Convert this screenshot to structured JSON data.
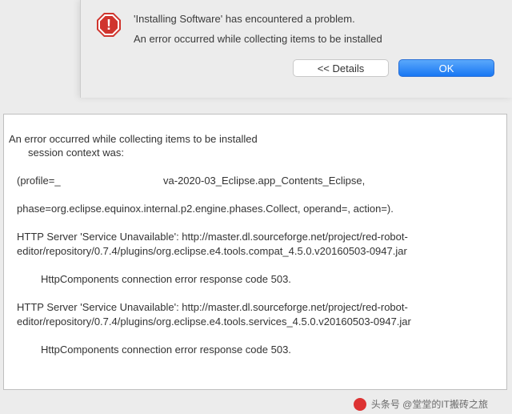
{
  "dialog": {
    "title": "'Installing Software' has encountered a problem.",
    "subtitle": "An error occurred while collecting items to be installed",
    "buttons": {
      "details": "<< Details",
      "ok": "OK"
    }
  },
  "details": {
    "line1": "An error occurred while collecting items to be installed",
    "line2": "session context was:",
    "line3a": "(profile=_",
    "line3b": "va-2020-03_Eclipse.app_Contents_Eclipse,",
    "line4": "phase=org.eclipse.equinox.internal.p2.engine.phases.Collect, operand=, action=).",
    "line5": "HTTP Server 'Service Unavailable': http://master.dl.sourceforge.net/project/red-robot-editor/repository/0.7.4/plugins/org.eclipse.e4.tools.compat_4.5.0.v20160503-0947.jar",
    "line6": "HttpComponents connection error response code 503.",
    "line7": "HTTP Server 'Service Unavailable': http://master.dl.sourceforge.net/project/red-robot-editor/repository/0.7.4/plugins/org.eclipse.e4.tools.services_4.5.0.v20160503-0947.jar",
    "line8": "HttpComponents connection error response code 503."
  },
  "watermark": {
    "text": "头条号 @堂堂的IT搬砖之旅"
  }
}
